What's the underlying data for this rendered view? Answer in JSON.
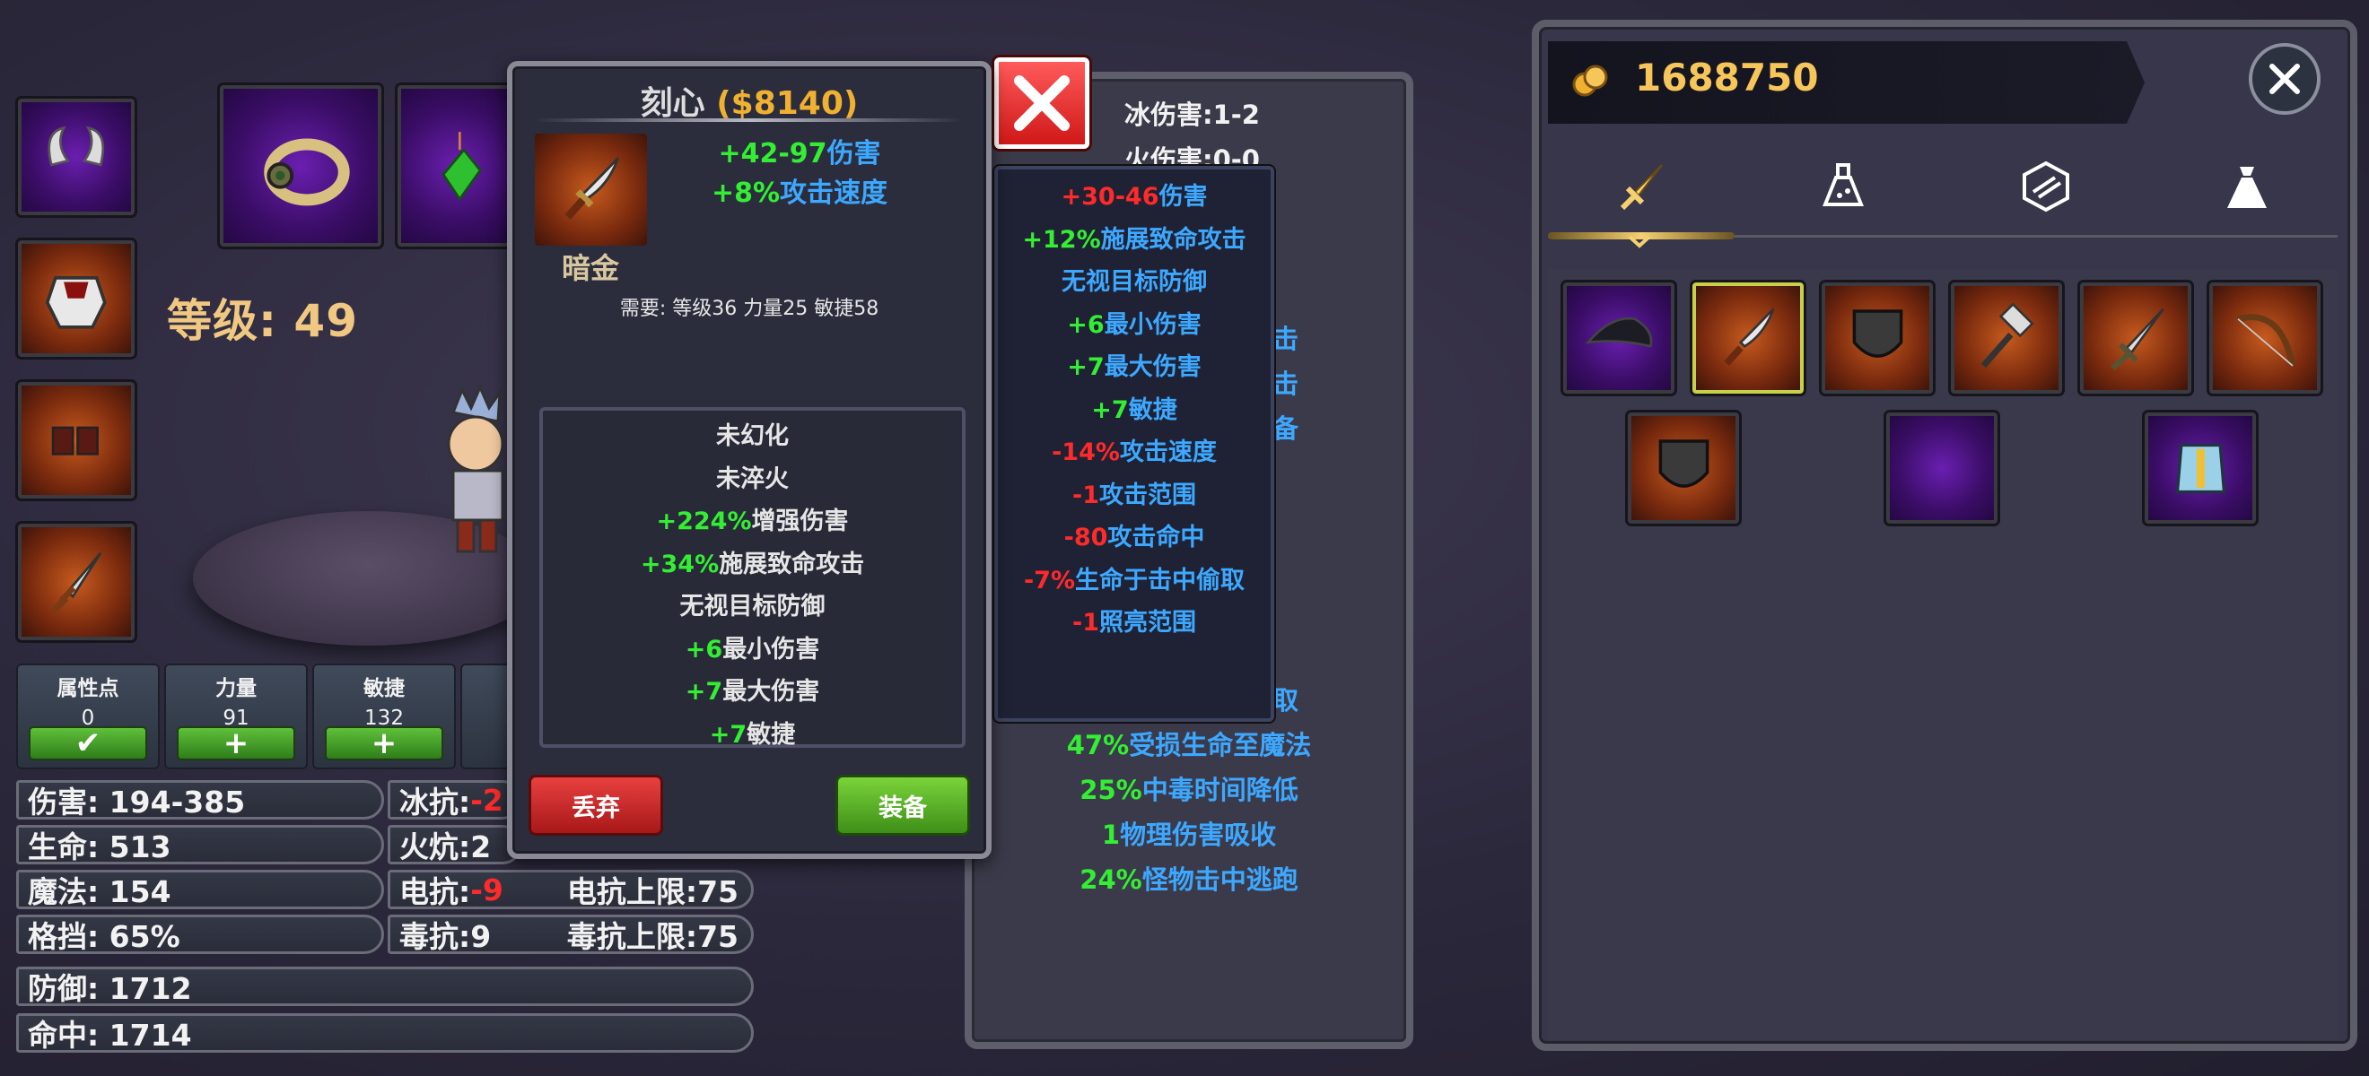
{
  "hero": {
    "level_text": "等级: 49"
  },
  "attributes": [
    {
      "title": "属性点",
      "value": "0",
      "button": "✔"
    },
    {
      "title": "力量",
      "value": "91",
      "button": "+"
    },
    {
      "title": "敏捷",
      "value": "132",
      "button": "+"
    }
  ],
  "stats": {
    "damage": "伤害: 194-385",
    "life": "生命: 513",
    "mana": "魔法: 154",
    "block": "格挡: 65%",
    "defense": "防御: 1712",
    "hit": "命中: 1714",
    "ice_res_label": "冰抗: ",
    "ice_res_value": "-2",
    "fire_res": "火炕:2",
    "elec_res_label": "电抗: ",
    "elec_res_value": "-9",
    "elec_res_cap": "电抗上限:75",
    "poison_res": "毒抗:9",
    "poison_res_cap": "毒抗上限:75"
  },
  "mid_panel": {
    "ice_damage": "冰伤害:1-2",
    "fire_damage": "火伤害:0-0",
    "partial_1": "击",
    "partial_2": "击",
    "partial_3": "备",
    "partial_4": "取",
    "bottom": [
      {
        "num": "47%",
        "text": "受损生命至魔法"
      },
      {
        "num": "25%",
        "text": "中毒时间降低"
      },
      {
        "num": "1",
        "text": "物理伤害吸收"
      },
      {
        "num": "24%",
        "text": "怪物击中逃跑"
      }
    ]
  },
  "compare_tooltip": {
    "lines": [
      {
        "num": "+30-46",
        "text": "伤害",
        "num_color": "#ff2a2a"
      },
      {
        "num": "+12%",
        "text": "施展致命攻击",
        "num_color": "#33ee33"
      },
      {
        "num": "",
        "text": "无视目标防御",
        "num_color": "#33ee33"
      },
      {
        "num": "+6",
        "text": "最小伤害",
        "num_color": "#33ee33"
      },
      {
        "num": "+7",
        "text": "最大伤害",
        "num_color": "#33ee33"
      },
      {
        "num": "+7",
        "text": "敏捷",
        "num_color": "#33ee33"
      },
      {
        "num": "-14%",
        "text": "攻击速度",
        "num_color": "#ff2a2a"
      },
      {
        "num": "-1",
        "text": "攻击范围",
        "num_color": "#ff2a2a"
      },
      {
        "num": "-80",
        "text": "攻击命中",
        "num_color": "#ff2a2a"
      },
      {
        "num": "-7%",
        "text": "生命于击中偷取",
        "num_color": "#ff2a2a"
      },
      {
        "num": "-1",
        "text": "照亮范围",
        "num_color": "#ff2a2a"
      }
    ]
  },
  "item_popup": {
    "name": "刻心",
    "price": "($8140)",
    "rarity": "暗金",
    "damage_num": "+42-97",
    "damage_text": "伤害",
    "speed_num": "+8%",
    "speed_text": "攻击速度",
    "requirements": "需要: 等级36 力量25 敏捷58",
    "properties": [
      {
        "num": "",
        "text": "未幻化",
        "color": "#e6e6e6"
      },
      {
        "num": "",
        "text": "未淬火",
        "color": "#e6e6e6"
      },
      {
        "num": "+224%",
        "text": "增强伤害",
        "color": "#e6e6e6"
      },
      {
        "num": "+34%",
        "text": "施展致命攻击",
        "color": "#e6e6e6"
      },
      {
        "num": "",
        "text": "无视目标防御",
        "color": "#e6e6e6"
      },
      {
        "num": "+6",
        "text": "最小伤害",
        "color": "#e6e6e6"
      },
      {
        "num": "+7",
        "text": "最大伤害",
        "color": "#e6e6e6"
      },
      {
        "num": "+7",
        "text": "敏捷",
        "color": "#e6e6e6"
      }
    ],
    "drop_label": "丢弃",
    "equip_label": "装备"
  },
  "inventory": {
    "gold": "1688750",
    "tabs": [
      "sword-icon",
      "potion-icon",
      "gem-icon",
      "bag-icon"
    ],
    "active_tab": 0
  },
  "colors": {
    "accent_gold": "#f0b030",
    "positive": "#33ee33",
    "negative": "#ff2a2a",
    "label_blue": "#3da8ff"
  }
}
